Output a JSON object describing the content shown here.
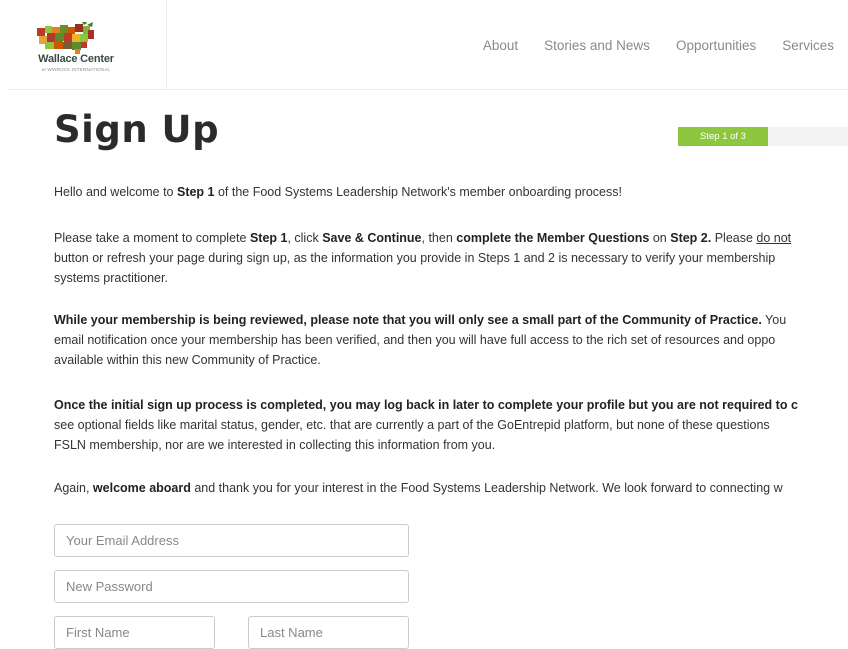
{
  "header": {
    "logo_title": "Wallace Center",
    "logo_subtitle": "at WINROCK INTERNATIONAL",
    "nav": [
      "About",
      "Stories and News",
      "Opportunities",
      "Services"
    ]
  },
  "page": {
    "title": "Sign Up",
    "step_label": "Step 1 of 3",
    "step_progress": 0.33
  },
  "intro": {
    "p1": {
      "a": "Hello and welcome to ",
      "b": "Step 1",
      "c": " of the Food Systems Leadership Network's member onboarding process!"
    },
    "p2": {
      "a": "Please take a moment to complete ",
      "b": "Step 1",
      "c": ", click ",
      "d": "Save & Continue",
      "e": ", then ",
      "f": "complete the Member Questions",
      "g": " on ",
      "h": "Step 2.",
      "i": " Please ",
      "j": "do not",
      "line2": "button or refresh your page during sign up, as the information you provide in Steps 1 and 2 is necessary to verify your membership",
      "line3": "systems practitioner."
    },
    "p3": {
      "bold": "While your membership is being reviewed, please note that you will only see a small part of the Community of Practice.",
      "rest": " You",
      "line2": "email notification once your membership has been verified, and then you will have full access to the rich set of resources and oppo",
      "line3": "available within this new Community of Practice."
    },
    "p4": {
      "bold": "Once the initial sign up process is completed, you may log back in later to complete your profile but you are not required to c",
      "line2": "see optional fields like marital status, gender, etc. that are currently a part of the GoEntrepid platform, but none of these questions",
      "line3": "FSLN membership, nor are we interested in collecting this information from you."
    },
    "p5": {
      "a": "Again, ",
      "b": "welcome aboard",
      "c": " and thank you for your interest in the Food Systems Leadership Network. We look forward to connecting w"
    }
  },
  "form": {
    "email_placeholder": "Your Email Address",
    "password_placeholder": "New Password",
    "first_name_placeholder": "First Name",
    "last_name_placeholder": "Last Name"
  },
  "colors": {
    "progress_fill": "#8dc63f",
    "progress_track": "#f4f4f4",
    "nav_text": "#8a8a8a"
  }
}
